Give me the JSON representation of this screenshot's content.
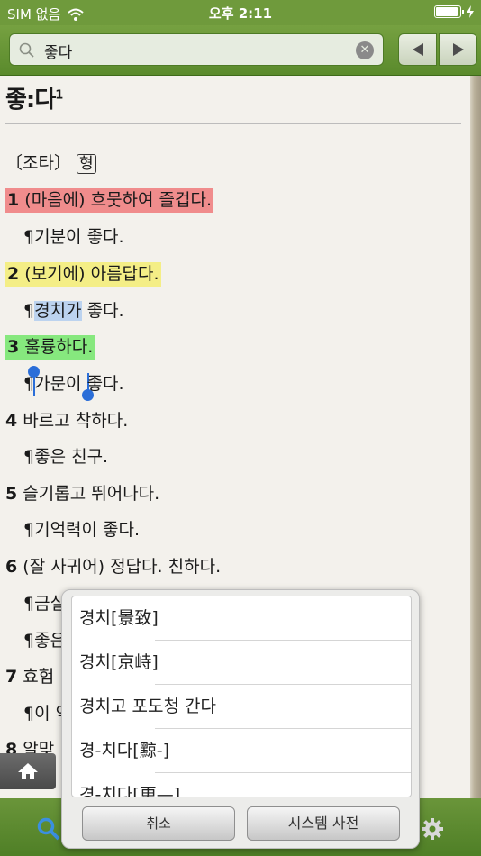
{
  "status_bar": {
    "carrier": "SIM 없음",
    "time": "오후 2:11",
    "battery_level": 0.85
  },
  "search": {
    "value": "좋다"
  },
  "entry": {
    "headword": "좋:다",
    "superscript": "1",
    "grammar": "〔조타〕",
    "pos": "형",
    "senses": [
      {
        "num": "1",
        "def": "(마음에) 흐뭇하여 즐겁다.",
        "example": "¶기분이 좋다."
      },
      {
        "num": "2",
        "def": "(보기에) 아름답다.",
        "example_pre": "¶",
        "example_sel": "경치가",
        "example_post": " 좋다."
      },
      {
        "num": "3",
        "def": "훌륭하다.",
        "example": "¶가문이 좋다."
      },
      {
        "num": "4",
        "def": "바르고 착하다.",
        "example": "¶좋은 친구."
      },
      {
        "num": "5",
        "def": "슬기롭고 뛰어나다.",
        "example": "¶기억력이 좋다."
      },
      {
        "num": "6",
        "def": "(잘 사귀어) 정답다. 친하다.",
        "example": "¶금실",
        "example2": "¶좋은"
      },
      {
        "num": "7",
        "def": "효험",
        "example": "¶이 약"
      },
      {
        "num": "8",
        "def": "알맞"
      }
    ]
  },
  "popup": {
    "items": [
      "경치[景致]",
      "경치[京峙]",
      "경치고 포도청 간다",
      "경-치다[黥-]",
      "경-치다[更—]"
    ],
    "cancel_label": "취소",
    "system_dict_label": "시스템 사전"
  },
  "colors": {
    "accent_green": "#6f9a3c",
    "highlight_red": "#f08c8c",
    "highlight_yellow": "#f4ee86",
    "highlight_green": "#86e87e",
    "selection": "#bcd3ef"
  }
}
